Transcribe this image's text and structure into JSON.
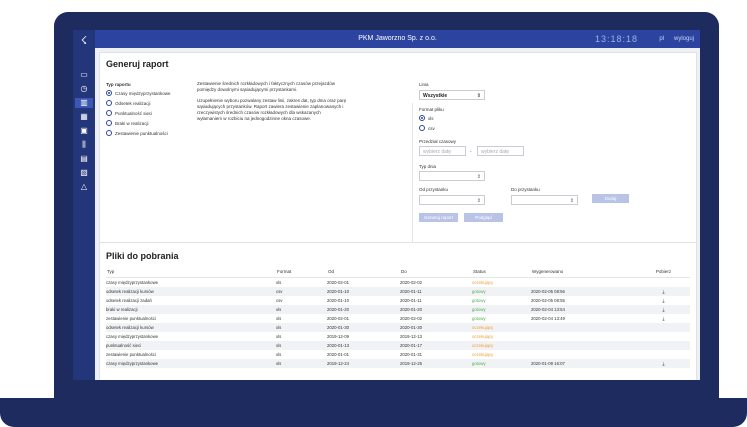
{
  "topbar": {
    "company": "PKM Jaworzno Sp. z o.o.",
    "clock": "13:18:18",
    "lang": "pl",
    "logout": "wyloguj"
  },
  "sidebar": {
    "logo": "logo-icon",
    "icons": [
      "monitor-icon",
      "clock-icon",
      "chart-icon",
      "calendar-icon",
      "bus-display-icon",
      "road-icon",
      "bus-icon",
      "report-icon",
      "warning-icon"
    ]
  },
  "generate": {
    "title": "Generuj raport",
    "type_label": "Typ raportu",
    "types": [
      "Czasy międzyprzystankowe",
      "Odsetek realizacji",
      "Punktualność sieci",
      "Braki w realizacji",
      "Zestawienie punktualności"
    ],
    "desc1": "Zestawienie średnich rozkładowych i faktycznych czasów przejazdów pomiędzy dowolnymi sąsiadującymi przystankami.",
    "desc2": "Uzupełnienie wyboru pozwalany zestaw linii, zakres dat, typ dnia oraz parę sąsiadujących przystanków. Raport zawiera zestawienie zaplanowanych i rzeczywistych średnich czasów rozkładowych dla wskazanych wyłamaniem w rozbiciu na jednogodzinne okna czasowe.",
    "line_label": "Linia",
    "line_value": "Wszystkie",
    "format_label": "Format pliku",
    "formats": [
      "xls",
      "csv"
    ],
    "range_label": "Przedział czasowy",
    "date_from_ph": "wybierz datę",
    "date_sep": "-",
    "date_to_ph": "wybierz datę",
    "daytype_label": "Typ dnia",
    "from_stop_label": "Od przystanku",
    "to_stop_label": "Do przystanku",
    "add_btn": "Dodaj",
    "generate_btn": "Generuj raport",
    "preview_btn": "Podgląd"
  },
  "downloads": {
    "title": "Pliki do pobrania",
    "headers": [
      "Typ",
      "Format",
      "Od",
      "Do",
      "Status",
      "Wygenerowano",
      "Pobierz"
    ],
    "rows": [
      {
        "type": "czasy międzyprzystankowe",
        "format": "xls",
        "from": "2020-02-01",
        "to": "2020-02-02",
        "status": "oczekujący",
        "generated": "",
        "dl": ""
      },
      {
        "type": "odsetek realizacji kursów",
        "format": "csv",
        "from": "2020-01-10",
        "to": "2020-01-11",
        "status": "gotowy",
        "generated": "2020-02-05 08:56",
        "dl": "⤓"
      },
      {
        "type": "odsetek realizacji zadań",
        "format": "csv",
        "from": "2020-01-10",
        "to": "2020-01-11",
        "status": "gotowy",
        "generated": "2020-02-05 08:55",
        "dl": "⤓"
      },
      {
        "type": "braki w realizacji",
        "format": "xls",
        "from": "2020-01-20",
        "to": "2020-01-20",
        "status": "gotowy",
        "generated": "2020-02-04 13:54",
        "dl": "⤓"
      },
      {
        "type": "zestawienie punktualności",
        "format": "xls",
        "from": "2020-02-01",
        "to": "2020-02-02",
        "status": "gotowy",
        "generated": "2020-02-04 13:49",
        "dl": "⤓"
      },
      {
        "type": "odsetek realizacji kursów",
        "format": "xls",
        "from": "2020-01-30",
        "to": "2020-01-30",
        "status": "oczekujący",
        "generated": "",
        "dl": ""
      },
      {
        "type": "czasy międzyprzystankowe",
        "format": "xls",
        "from": "2019-12-09",
        "to": "2019-12-13",
        "status": "oczekujący",
        "generated": "",
        "dl": ""
      },
      {
        "type": "punktualność sieci",
        "format": "xls",
        "from": "2020-01-13",
        "to": "2020-01-17",
        "status": "oczekujący",
        "generated": "",
        "dl": ""
      },
      {
        "type": "zestawienie punktualności",
        "format": "xls",
        "from": "2020-01-01",
        "to": "2020-01-31",
        "status": "oczekujący",
        "generated": "",
        "dl": ""
      },
      {
        "type": "czasy międzyprzystankowe",
        "format": "xls",
        "from": "2019-12-24",
        "to": "2019-12-25",
        "status": "gotowy",
        "generated": "2020-01-09 16:07",
        "dl": "⤓"
      }
    ]
  },
  "colors": {
    "navy": "#1d2b5e",
    "topbar": "#2c44a0",
    "ok": "#4caf50",
    "wait": "#f0a030"
  }
}
